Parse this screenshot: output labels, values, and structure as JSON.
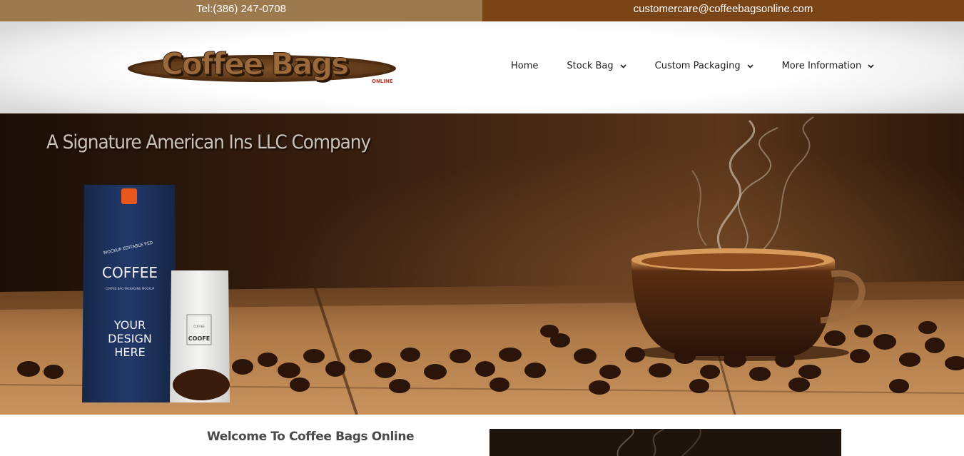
{
  "topbar": {
    "phone": "Tel:(386) 247-0708",
    "email": "customercare@coffeebagsonline.com"
  },
  "logo": {
    "text": "Coffee Bags",
    "sub": "ONLINE"
  },
  "nav": {
    "items": [
      {
        "label": "Home",
        "dropdown": false
      },
      {
        "label": "Stock Bag",
        "dropdown": true
      },
      {
        "label": "Custom Packaging",
        "dropdown": true
      },
      {
        "label": "More Information",
        "dropdown": true
      }
    ]
  },
  "hero": {
    "tagline": "A Signature American Ins LLC Company",
    "bag_blue": {
      "line1": "MOCKUP EDITABLE PSD",
      "line2": "COFFEE",
      "line3": "COFFEE BAG PACKAGING MOCKUP",
      "line4": "YOUR",
      "line5": "DESIGN",
      "line6": "HERE"
    },
    "bag_white": {
      "line1": "COFFEE",
      "line2": "COOFE"
    }
  },
  "content": {
    "welcome_title": "Welcome To Coffee Bags Online"
  },
  "colors": {
    "topbar_left": "#9c7a4e",
    "topbar_right": "#7a4416",
    "logo_brown": "#7a4a24",
    "logo_ellipse": "#5c3514",
    "bag_blue": "#1e3461",
    "accent_orange": "#e8581c"
  },
  "icons": {
    "chevron": "chevron-down-icon"
  }
}
